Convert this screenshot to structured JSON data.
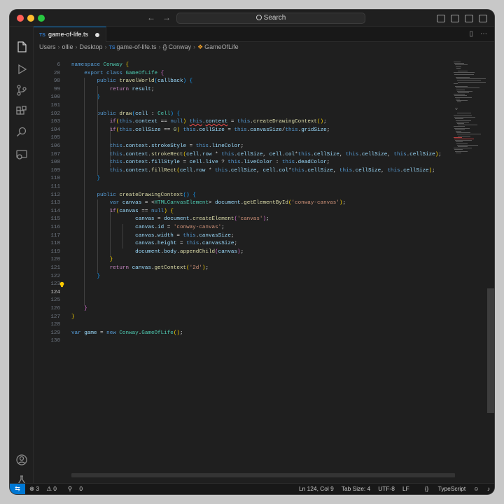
{
  "search": {
    "label": "Search"
  },
  "tab": {
    "badge": "TS",
    "label": "game-of-life.ts"
  },
  "breadcrumb": {
    "parts": [
      "Users",
      "ollie",
      "Desktop"
    ],
    "file_badge": "TS",
    "file": "game-of-life.ts",
    "ns_icon": "{}",
    "namespace": "Conway",
    "class_name": "GameOfLife"
  },
  "editor": {
    "line_numbers": [
      "6",
      "28",
      "98",
      "99",
      "100",
      "101",
      "102",
      "103",
      "104",
      "105",
      "106",
      "107",
      "108",
      "109",
      "110",
      "111",
      "112",
      "113",
      "114",
      "115",
      "116",
      "117",
      "118",
      "119",
      "120",
      "121",
      "122",
      "123",
      "124",
      "125",
      "126",
      "127",
      "128",
      "129",
      "130"
    ],
    "active_line": "124"
  },
  "status": {
    "errors": "3",
    "warnings": "0",
    "ports": "0",
    "position": "Ln 124, Col 9",
    "tab_size": "Tab Size: 4",
    "encoding": "UTF-8",
    "eol": "LF",
    "language_icon": "{}",
    "language": "TypeScript"
  },
  "colors": {
    "accent": "#0078d4",
    "error": "#f14c4c",
    "keyword": "#569cd6",
    "string": "#ce9178",
    "type": "#4ec9b0"
  }
}
